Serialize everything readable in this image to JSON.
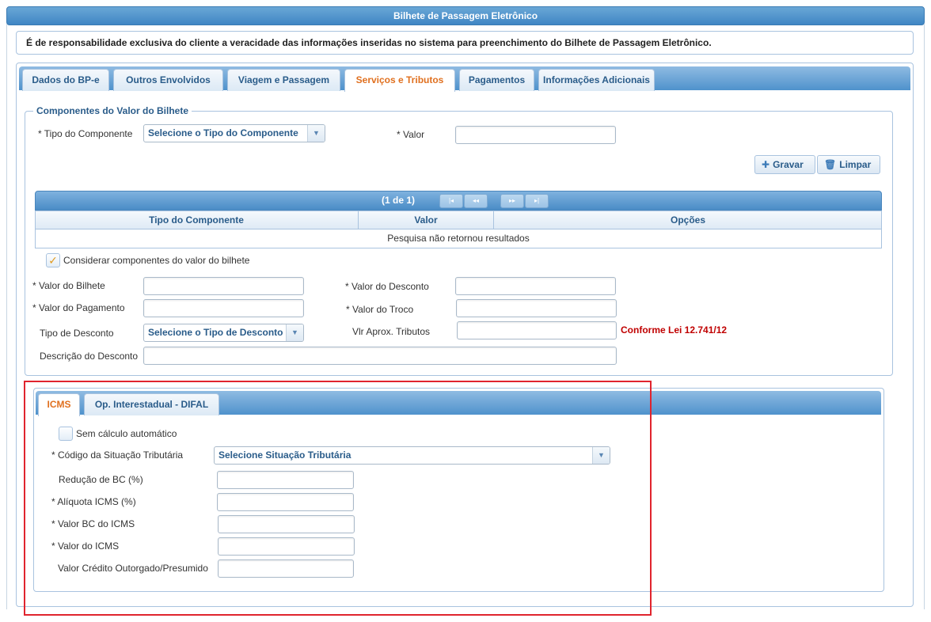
{
  "page": {
    "title": "Bilhete de Passagem Eletrônico",
    "notice": "É de responsabilidade exclusiva do cliente a veracidade das informações inseridas no sistema para preenchimento do Bilhete de Passagem Eletrônico."
  },
  "tabs": [
    {
      "label": "Dados do BP-e",
      "active": false
    },
    {
      "label": "Outros Envolvidos",
      "active": false
    },
    {
      "label": "Viagem e Passagem",
      "active": false
    },
    {
      "label": "Serviços e Tributos",
      "active": true
    },
    {
      "label": "Pagamentos",
      "active": false
    },
    {
      "label": "Informações Adicionais",
      "active": false
    }
  ],
  "components": {
    "legend": "Componentes do Valor do Bilhete",
    "tipo_label": "* Tipo do Componente",
    "tipo_select": "Selecione o Tipo do Componente",
    "valor_label": "* Valor",
    "gravar": "Gravar",
    "limpar": "Limpar",
    "grid": {
      "pager": "(1 de 1)",
      "columns": [
        "Tipo do Componente",
        "Valor",
        "Opções"
      ],
      "empty": "Pesquisa não retornou resultados"
    }
  },
  "valores": {
    "considerar_label": "Considerar componentes do valor do bilhete",
    "considerar_checked": true,
    "valor_bilhete": "* Valor do Bilhete",
    "valor_desconto": "* Valor do Desconto",
    "valor_pagamento": "* Valor do Pagamento",
    "valor_troco": "* Valor do Troco",
    "tipo_desconto": "Tipo de Desconto",
    "tipo_desconto_select": "Selecione o Tipo de Desconto",
    "vlr_aprox": "Vlr Aprox. Tributos",
    "lei": "Conforme Lei 12.741/12",
    "descricao_desconto": "Descrição do Desconto"
  },
  "icms": {
    "tabs": [
      {
        "label": "ICMS",
        "active": true
      },
      {
        "label": "Op. Interestadual - DIFAL",
        "active": false
      }
    ],
    "sem_calculo": "Sem cálculo automático",
    "cst_label": "* Código da Situação Tributária",
    "cst_select": "Selecione Situação Tributária",
    "reducao_bc": "Redução de BC (%)",
    "aliquota": "* Alíquota ICMS (%)",
    "valor_bc": "* Valor BC do ICMS",
    "valor_icms": "* Valor do ICMS",
    "credito": "Valor Crédito Outorgado/Presumido"
  },
  "colors": {
    "accent": "#e0701f",
    "header_blue": "#4f92cc",
    "highlight_red": "#e0242e"
  }
}
